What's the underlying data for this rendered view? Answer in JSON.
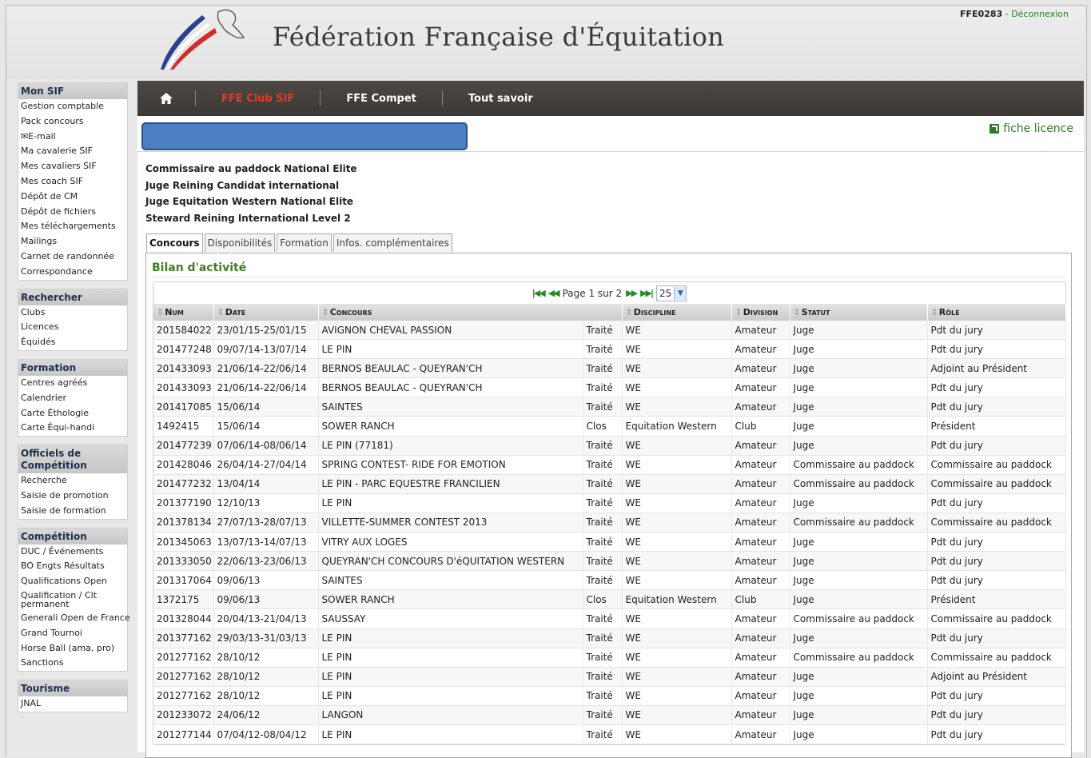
{
  "header": {
    "site_title": "Fédération Française d'Équitation",
    "user_id": "FFE0283",
    "user_sep": " - ",
    "logout": "Déconnexion"
  },
  "sidebar": {
    "sections": [
      {
        "title": "Mon SIF",
        "items": [
          "Gestion comptable",
          "Pack concours",
          "✉E-mail",
          "Ma cavalerie SIF",
          "Mes cavaliers SIF",
          "Mes coach SIF",
          "Dépôt de CM",
          "Dépôt de fichiers",
          "Mes téléchargements",
          "Mailings",
          "Carnet de randonnée",
          "Correspondance"
        ]
      },
      {
        "title": "Rechercher",
        "items": [
          "Clubs",
          "Licences",
          "Équidés"
        ]
      },
      {
        "title": "Formation",
        "items": [
          "Centres agréés",
          "Calendrier",
          "Carte Éthologie",
          "Carte Équi-handi"
        ]
      },
      {
        "title": "Officiels de Compétition",
        "items": [
          "Recherche",
          "Saisie de promotion",
          "Saisie de formation"
        ]
      },
      {
        "title": "Compétition",
        "items": [
          "DUC / Événements",
          "BO Engts Résultats",
          "Qualifications Open",
          "Qualification / Clt permanent",
          "Generali Open de France",
          "Grand Tournoi",
          "Horse Ball (ama, pro)",
          "Sanctions"
        ]
      },
      {
        "title": "Tourisme",
        "items": [
          "JNAL"
        ]
      }
    ]
  },
  "nav": {
    "home_icon": "home-icon",
    "items": [
      {
        "label": "FFE Club SIF",
        "active": true
      },
      {
        "label": "FFE Compet",
        "active": false
      },
      {
        "label": "Tout savoir",
        "active": false
      }
    ]
  },
  "fiche_licence": "fiche licence",
  "roles": [
    "Commissaire au paddock National Elite",
    "Juge Reining Candidat international",
    "Juge Equitation Western National Elite",
    "Steward Reining International Level 2"
  ],
  "tabs": [
    {
      "label": "Concours",
      "active": true
    },
    {
      "label": "Disponibilités",
      "active": false
    },
    {
      "label": "Formation",
      "active": false
    },
    {
      "label": "Infos. complémentaires",
      "active": false
    }
  ],
  "panel": {
    "title": "Bilan d'activité",
    "pager": {
      "text": "Page 1 sur 2",
      "page_size": "25"
    }
  },
  "table": {
    "columns": [
      "Num",
      "Date",
      "Concours",
      "",
      "Discipline",
      "Division",
      "Statut",
      "Rôle"
    ],
    "rows": [
      [
        "201584022",
        "23/01/15-25/01/15",
        "AVIGNON CHEVAL PASSION",
        "Traité",
        "WE",
        "Amateur",
        "Juge",
        "Pdt du jury"
      ],
      [
        "201477248",
        "09/07/14-13/07/14",
        "LE PIN",
        "Traité",
        "WE",
        "Amateur",
        "Juge",
        "Pdt du jury"
      ],
      [
        "201433093",
        "21/06/14-22/06/14",
        "BERNOS BEAULAC - QUEYRAN'CH",
        "Traité",
        "WE",
        "Amateur",
        "Juge",
        "Adjoint au Président"
      ],
      [
        "201433093",
        "21/06/14-22/06/14",
        "BERNOS BEAULAC - QUEYRAN'CH",
        "Traité",
        "WE",
        "Amateur",
        "Juge",
        "Pdt du jury"
      ],
      [
        "201417085",
        "15/06/14",
        "SAINTES",
        "Traité",
        "WE",
        "Amateur",
        "Juge",
        "Pdt du jury"
      ],
      [
        "1492415",
        "15/06/14",
        "SOWER RANCH",
        "Clos",
        "Equitation Western",
        "Club",
        "Juge",
        "Président"
      ],
      [
        "201477239",
        "07/06/14-08/06/14",
        "LE PIN (77181)",
        "Traité",
        "WE",
        "Amateur",
        "Juge",
        "Pdt du jury"
      ],
      [
        "201428046",
        "26/04/14-27/04/14",
        "SPRING CONTEST- RIDE FOR EMOTION",
        "Traité",
        "WE",
        "Amateur",
        "Commissaire au paddock",
        "Commissaire au paddock"
      ],
      [
        "201477232",
        "13/04/14",
        "LE PIN - PARC EQUESTRE FRANCILIEN",
        "Traité",
        "WE",
        "Amateur",
        "Commissaire au paddock",
        "Commissaire au paddock"
      ],
      [
        "201377190",
        "12/10/13",
        "LE PIN",
        "Traité",
        "WE",
        "Amateur",
        "Juge",
        "Pdt du jury"
      ],
      [
        "201378134",
        "27/07/13-28/07/13",
        "VILLETTE-SUMMER CONTEST 2013",
        "Traité",
        "WE",
        "Amateur",
        "Commissaire au paddock",
        "Commissaire au paddock"
      ],
      [
        "201345063",
        "13/07/13-14/07/13",
        "VITRY AUX LOGES",
        "Traité",
        "WE",
        "Amateur",
        "Juge",
        "Pdt du jury"
      ],
      [
        "201333050",
        "22/06/13-23/06/13",
        "QUEYRAN'CH CONCOURS D'éQUITATION WESTERN",
        "Traité",
        "WE",
        "Amateur",
        "Juge",
        "Pdt du jury"
      ],
      [
        "201317064",
        "09/06/13",
        "SAINTES",
        "Traité",
        "WE",
        "Amateur",
        "Juge",
        "Pdt du jury"
      ],
      [
        "1372175",
        "09/06/13",
        "SOWER RANCH",
        "Clos",
        "Equitation Western",
        "Club",
        "Juge",
        "Président"
      ],
      [
        "201328044",
        "20/04/13-21/04/13",
        "SAUSSAY",
        "Traité",
        "WE",
        "Amateur",
        "Commissaire au paddock",
        "Commissaire au paddock"
      ],
      [
        "201377162",
        "29/03/13-31/03/13",
        "LE PIN",
        "Traité",
        "WE",
        "Amateur",
        "Juge",
        "Pdt du jury"
      ],
      [
        "201277162",
        "28/10/12",
        "LE PIN",
        "Traité",
        "WE",
        "Amateur",
        "Commissaire au paddock",
        "Commissaire au paddock"
      ],
      [
        "201277162",
        "28/10/12",
        "LE PIN",
        "Traité",
        "WE",
        "Amateur",
        "Juge",
        "Adjoint au Président"
      ],
      [
        "201277162",
        "28/10/12",
        "LE PIN",
        "Traité",
        "WE",
        "Amateur",
        "Juge",
        "Pdt du jury"
      ],
      [
        "201233072",
        "24/06/12",
        "LANGON",
        "Traité",
        "WE",
        "Amateur",
        "Juge",
        "Pdt du jury"
      ],
      [
        "201277144",
        "07/04/12-08/04/12",
        "LE PIN",
        "Traité",
        "WE",
        "Amateur",
        "Juge",
        "Pdt du jury"
      ]
    ]
  }
}
